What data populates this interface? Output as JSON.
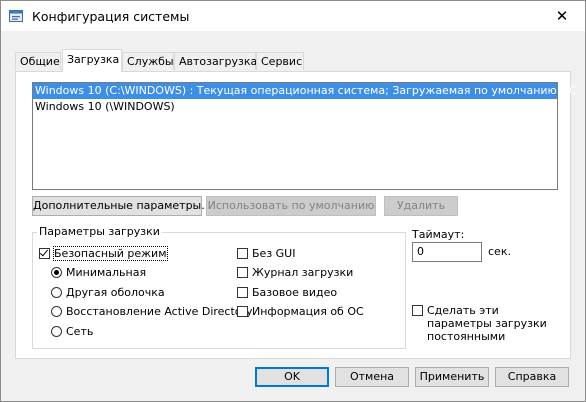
{
  "window": {
    "title": "Конфигурация системы",
    "close_glyph": "✕"
  },
  "tabs": [
    {
      "label": "Общие",
      "active": false
    },
    {
      "label": "Загрузка",
      "active": true
    },
    {
      "label": "Службы",
      "active": false
    },
    {
      "label": "Автозагрузка",
      "active": false
    },
    {
      "label": "Сервис",
      "active": false
    }
  ],
  "boot_list": {
    "items": [
      {
        "label": "Windows 10 (C:\\WINDOWS) : Текущая операционная система; Загружаемая по умолчанию ОС",
        "selected": true
      },
      {
        "label": "Windows 10 (\\WINDOWS)",
        "selected": false
      }
    ]
  },
  "boot_buttons": {
    "advanced": "Дополнительные параметры...",
    "set_default": "Использовать по умолчанию",
    "delete": "Удалить"
  },
  "boot_options": {
    "group_title": "Параметры загрузки",
    "safe_boot": {
      "label": "Безопасный режим",
      "checked": true
    },
    "minimal": {
      "label": "Минимальная",
      "checked": true
    },
    "alternate_shell": {
      "label": "Другая оболочка",
      "checked": false
    },
    "ad_repair": {
      "label": "Восстановление Active Directory",
      "checked": false
    },
    "network": {
      "label": "Сеть",
      "checked": false
    },
    "no_gui": {
      "label": "Без GUI",
      "checked": false
    },
    "boot_log": {
      "label": "Журнал загрузки",
      "checked": false
    },
    "base_video": {
      "label": "Базовое видео",
      "checked": false
    },
    "os_info": {
      "label": "Информация  об ОС",
      "checked": false
    }
  },
  "timeout": {
    "label": "Таймаут:",
    "value": "0",
    "unit": "сек."
  },
  "persist": {
    "label": "Сделать эти параметры загрузки постоянными",
    "checked": false
  },
  "dialog_buttons": {
    "ok": "OK",
    "cancel": "Отмена",
    "apply": "Применить",
    "help": "Справка"
  },
  "colors": {
    "selection": "#3d8ee6",
    "default_button_border": "#0078d7"
  }
}
